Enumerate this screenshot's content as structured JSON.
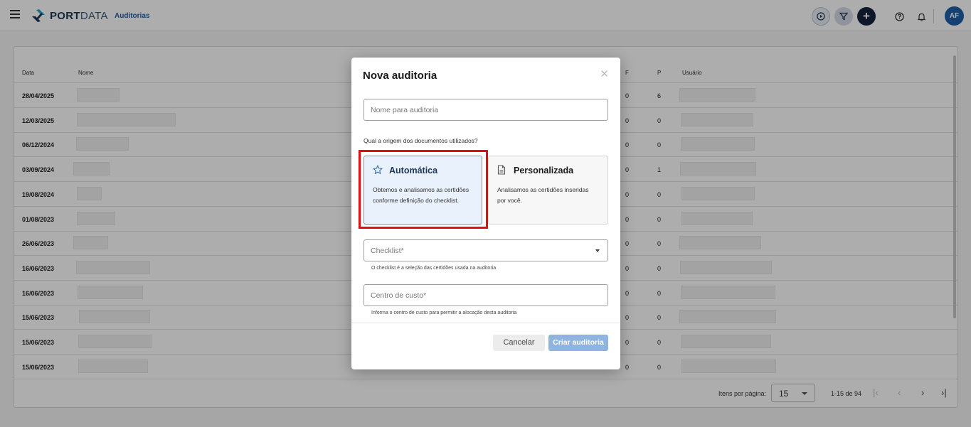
{
  "topbar": {
    "logo_bold": "PORT",
    "logo_thin": "DATA",
    "section_title": "Auditorias",
    "avatar_initials": "AF",
    "accent_color": "#1f5fa8",
    "icons": [
      "menu-icon",
      "play-icon",
      "filter-icon",
      "plus-icon",
      "help-icon",
      "bell-icon"
    ]
  },
  "table": {
    "headers": {
      "date": "Data",
      "name": "Nome",
      "f": "F",
      "p": "P",
      "user": "Usuário"
    },
    "rows": [
      {
        "date": "28/04/2025",
        "f": "0",
        "p": "6"
      },
      {
        "date": "12/03/2025",
        "f": "0",
        "p": "0"
      },
      {
        "date": "06/12/2024",
        "f": "0",
        "p": "0"
      },
      {
        "date": "03/09/2024",
        "f": "0",
        "p": "1"
      },
      {
        "date": "19/08/2024",
        "f": "0",
        "p": "0"
      },
      {
        "date": "01/08/2023",
        "f": "0",
        "p": "0"
      },
      {
        "date": "26/06/2023",
        "f": "0",
        "p": "0"
      },
      {
        "date": "16/06/2023",
        "f": "0",
        "p": "0"
      },
      {
        "date": "16/06/2023",
        "f": "0",
        "p": "0"
      },
      {
        "date": "15/06/2023",
        "f": "0",
        "p": "0"
      },
      {
        "date": "15/06/2023",
        "f": "0",
        "p": "0"
      },
      {
        "date": "15/06/2023",
        "f": "0",
        "p": "0"
      }
    ]
  },
  "pager": {
    "items_label": "Itens por página:",
    "page_size": "15",
    "range": "1-15 de 94",
    "nav": {
      "first": "|‹",
      "prev": "‹",
      "next": "›",
      "last": "›|"
    }
  },
  "dialog": {
    "title": "Nova auditoria",
    "close": "✕",
    "name_placeholder": "Nome para auditoria",
    "question": "Qual a origem dos documentos utilizados?",
    "options": [
      {
        "title": "Automática",
        "description": "Obtemos e analisamos as certidões conforme definição do checklist.",
        "icon": "star-icon",
        "selected": true
      },
      {
        "title": "Personalizada",
        "description": "Analisamos as certidões inseridas por você.",
        "icon": "document-icon",
        "selected": false
      }
    ],
    "checklist_placeholder": "Checklist*",
    "checklist_hint": "O checklist é a seleção das certidões usada na auditoria",
    "cost_center_placeholder": "Centro de custo*",
    "cost_center_hint": "Informa o centro de custo para permitir a alocação desta auditoria",
    "cancel_label": "Cancelar",
    "create_label": "Criar auditoria"
  }
}
